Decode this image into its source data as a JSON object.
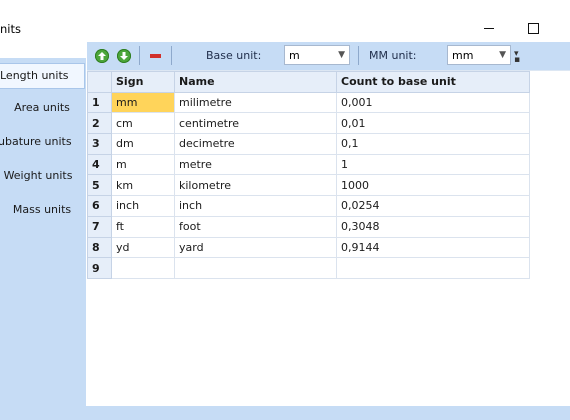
{
  "window": {
    "title": "nits"
  },
  "sidebar": {
    "tabs": [
      {
        "label": "Length units",
        "active": true
      },
      {
        "label": "Area units",
        "active": false
      },
      {
        "label": "ubature units",
        "active": false
      },
      {
        "label": "Weight units",
        "active": false
      },
      {
        "label": "Mass units",
        "active": false
      }
    ]
  },
  "toolbar": {
    "icons": [
      "move-up-icon",
      "move-down-icon",
      "delete-icon"
    ],
    "base_unit_label": "Base unit:",
    "base_unit_value": "m",
    "mm_unit_label": "MM unit:",
    "mm_unit_value": "mm"
  },
  "grid": {
    "columns": [
      "Sign",
      "Name",
      "Count to base unit"
    ],
    "rows": [
      {
        "num": "1",
        "sign": "mm",
        "name": "milimetre",
        "count": "0,001"
      },
      {
        "num": "2",
        "sign": "cm",
        "name": "centimetre",
        "count": "0,01"
      },
      {
        "num": "3",
        "sign": "dm",
        "name": "decimetre",
        "count": "0,1"
      },
      {
        "num": "4",
        "sign": "m",
        "name": "metre",
        "count": "1"
      },
      {
        "num": "5",
        "sign": "km",
        "name": "kilometre",
        "count": "1000"
      },
      {
        "num": "6",
        "sign": "inch",
        "name": "inch",
        "count": "0,0254"
      },
      {
        "num": "7",
        "sign": "ft",
        "name": "foot",
        "count": "0,3048"
      },
      {
        "num": "8",
        "sign": "yd",
        "name": "yard",
        "count": "0,9144"
      },
      {
        "num": "9",
        "sign": "",
        "name": "",
        "count": ""
      }
    ]
  },
  "colors": {
    "accent": "#c6dcf5",
    "selected_cell": "#ffd45a",
    "up_down_icon": "#4ca63a",
    "delete_icon": "#d1302a"
  }
}
